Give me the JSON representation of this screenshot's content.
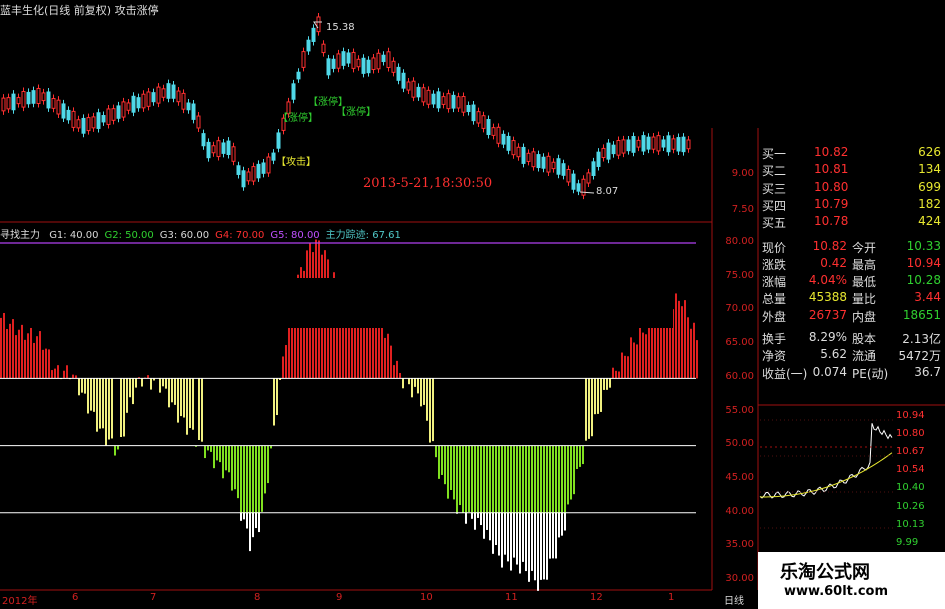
{
  "window": {
    "title": "蓝丰生化(日线 前复权) 攻击涨停",
    "period_label": "日线"
  },
  "price_chart": {
    "high_marker": "15.38",
    "low_marker": "8.07",
    "y_ticks": [
      "9.00",
      "7.50"
    ],
    "tags": [
      "【涨停】",
      "【涨停】",
      "【涨停】",
      "【攻击】"
    ],
    "timestamp": "2013-5-21,18:30:50"
  },
  "indicator": {
    "name": "寻找主力",
    "params": [
      {
        "label": "G1: 40.00",
        "color": "#d8d8d8"
      },
      {
        "label": "G2: 50.00",
        "color": "#30d030"
      },
      {
        "label": "G3: 60.00",
        "color": "#d8d8d8"
      },
      {
        "label": "G4: 70.00",
        "color": "#ff3030"
      },
      {
        "label": "G5: 80.00",
        "color": "#c050ff"
      },
      {
        "label": "主力踪迹: 67.61",
        "color": "#50c8c8"
      }
    ],
    "y_ticks": [
      "80.00",
      "75.00",
      "70.00",
      "65.00",
      "60.00",
      "55.00",
      "50.00",
      "45.00",
      "40.00",
      "35.00",
      "30.00"
    ]
  },
  "x_axis": [
    "2012年",
    "6",
    "7",
    "8",
    "9",
    "10",
    "11",
    "12",
    "1"
  ],
  "quote_panel": {
    "bids": [
      {
        "label": "买一",
        "price": "10.82",
        "vol": "626"
      },
      {
        "label": "买二",
        "price": "10.81",
        "vol": "134"
      },
      {
        "label": "买三",
        "price": "10.80",
        "vol": "699"
      },
      {
        "label": "买四",
        "price": "10.79",
        "vol": "182"
      },
      {
        "label": "买五",
        "price": "10.78",
        "vol": "424"
      }
    ],
    "stats": [
      {
        "l1": "现价",
        "v1": "10.82",
        "c1": "#ff3030",
        "l2": "今开",
        "v2": "10.33",
        "c2": "#30d030"
      },
      {
        "l1": "涨跌",
        "v1": "0.42",
        "c1": "#ff3030",
        "l2": "最高",
        "v2": "10.94",
        "c2": "#ff3030"
      },
      {
        "l1": "涨幅",
        "v1": "4.04%",
        "c1": "#ff3030",
        "l2": "最低",
        "v2": "10.28",
        "c2": "#30d030"
      },
      {
        "l1": "总量",
        "v1": "45388",
        "c1": "#e8e830",
        "l2": "量比",
        "v2": "3.44",
        "c2": "#ff3030"
      },
      {
        "l1": "外盘",
        "v1": "26737",
        "c1": "#ff3030",
        "l2": "内盘",
        "v2": "18651",
        "c2": "#30d030"
      }
    ],
    "fin": [
      {
        "l1": "换手",
        "v1": "8.29%",
        "l2": "股本",
        "v2": "2.13亿"
      },
      {
        "l1": "净资",
        "v1": "5.62",
        "l2": "流通",
        "v2": "5472万"
      },
      {
        "l1": "收益(一)",
        "v1": "0.074",
        "l2": "PE(动)",
        "v2": "36.7"
      }
    ],
    "intraday_ticks": [
      "10.94",
      "10.80",
      "10.67",
      "10.54",
      "10.40",
      "10.26",
      "10.13",
      "9.99"
    ]
  },
  "brand": {
    "name": "乐淘公式网",
    "url": "www.60lt.com"
  },
  "colors": {
    "red": "#e02020",
    "yellow": "#f0f080",
    "green": "#80e020",
    "white": "#ffffff",
    "grid_red": "#a01010"
  }
}
